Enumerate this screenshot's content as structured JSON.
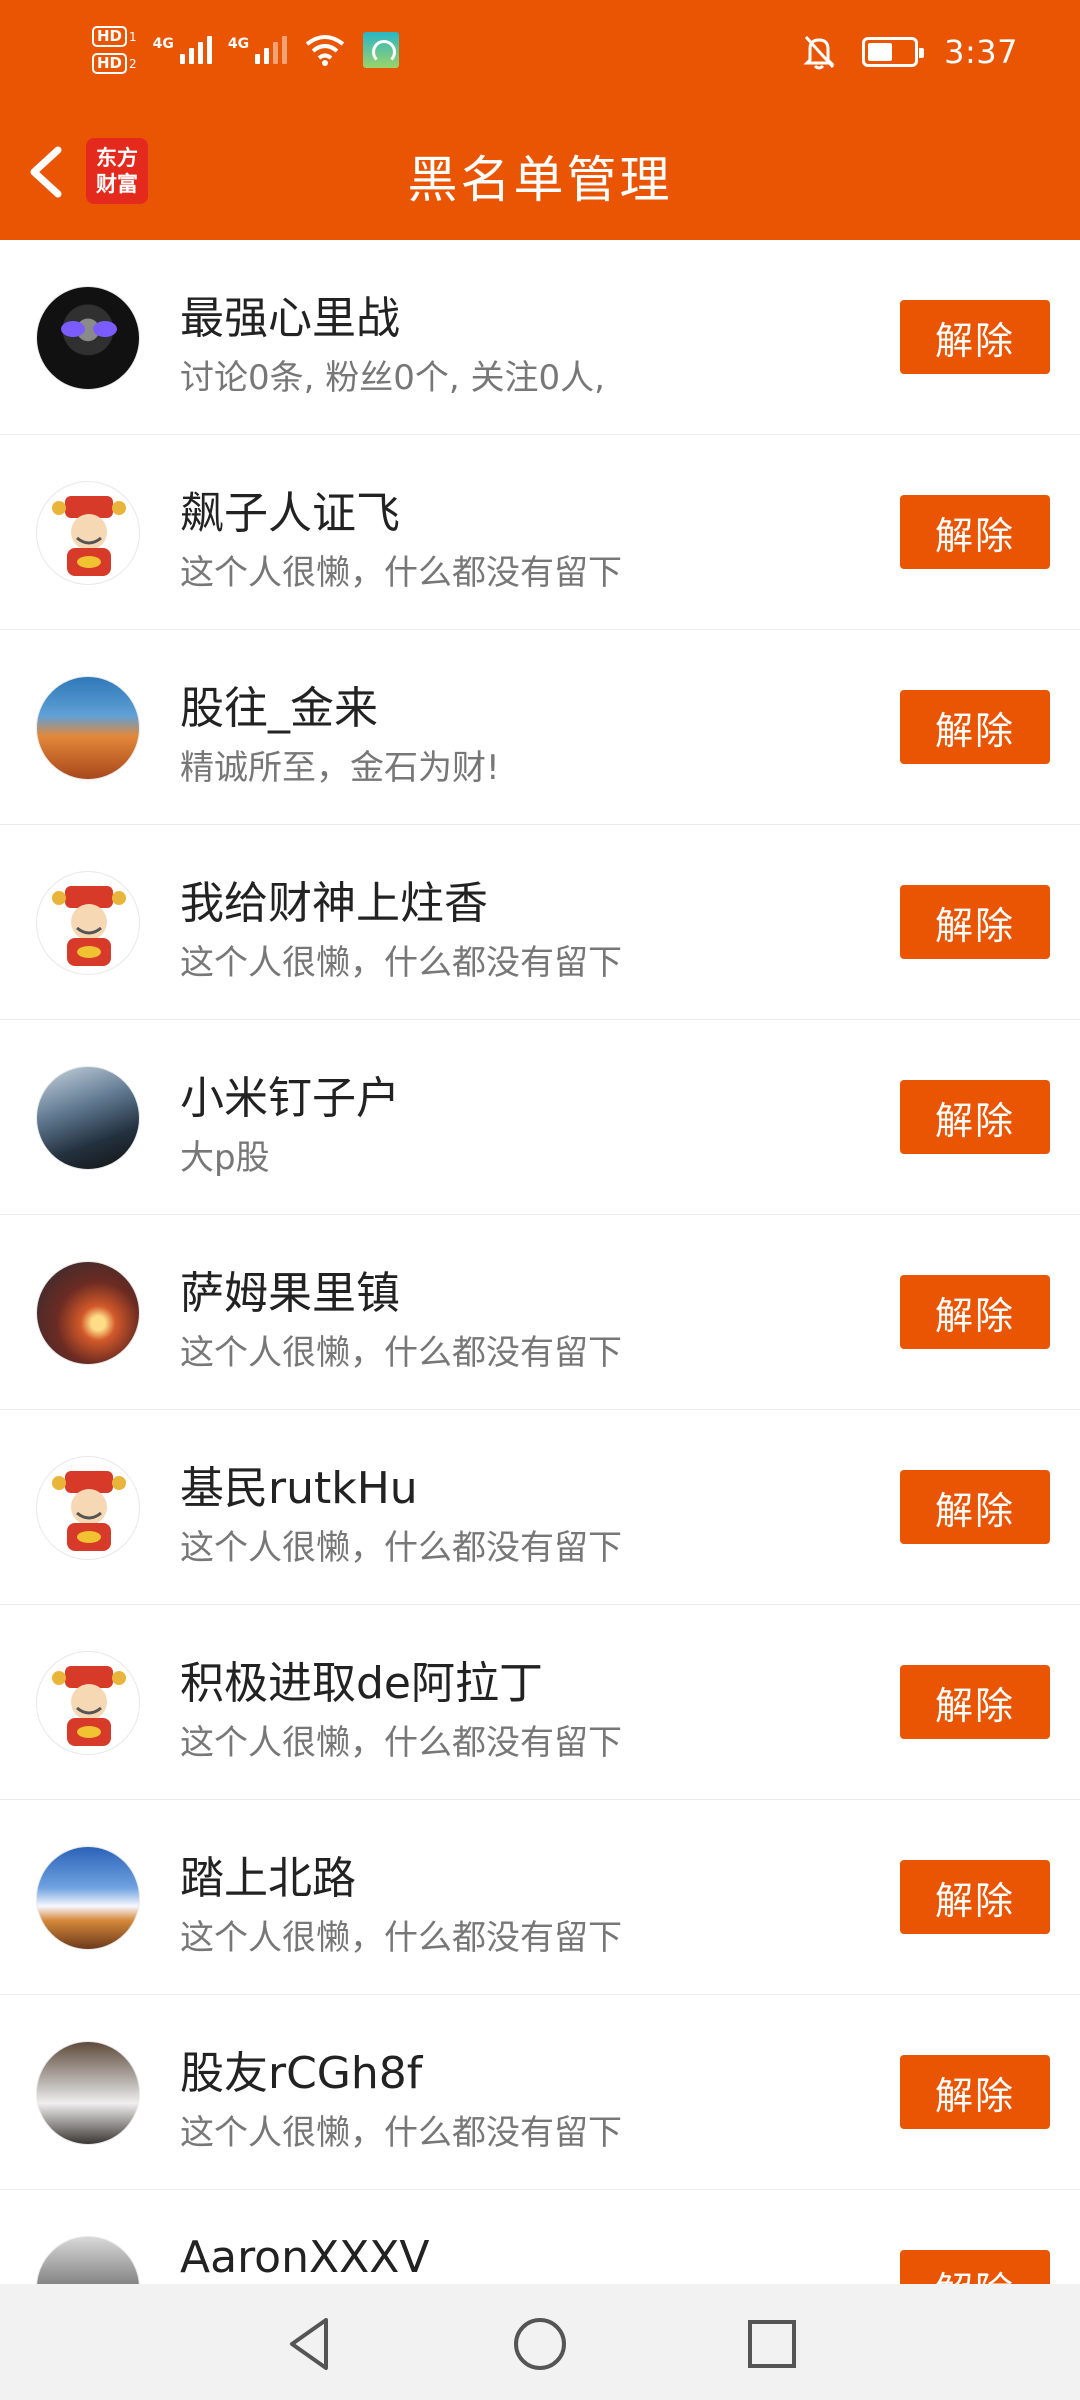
{
  "status_bar": {
    "sim1_label": "HD",
    "sim1_num": "1",
    "sim2_label": "HD",
    "sim2_num": "2",
    "net1": "4G",
    "net2": "4G",
    "time": "3:37"
  },
  "header": {
    "logo_line1": "东方",
    "logo_line2": "财富",
    "title": "黑名单管理"
  },
  "remove_label": "解除",
  "users": [
    {
      "name": "最强心里战",
      "desc": "讨论0条, 粉丝0个, 关注0人,",
      "avatar": "skull-avatar"
    },
    {
      "name": "飙子人证飞",
      "desc": "这个人很懒，什么都没有留下",
      "avatar": "fortune-god-avatar"
    },
    {
      "name": "股往_金来",
      "desc": "精诚所至，金石为财!",
      "avatar": "mountain-avatar"
    },
    {
      "name": "我给财神上炷香",
      "desc": "这个人很懒，什么都没有留下",
      "avatar": "fortune-god-avatar"
    },
    {
      "name": "小米钉子户",
      "desc": "大p股",
      "avatar": "seaside-person-avatar"
    },
    {
      "name": "萨姆果里镇",
      "desc": "这个人很懒，什么都没有留下",
      "avatar": "ironman-avatar"
    },
    {
      "name": "基民rutkHu",
      "desc": "这个人很懒，什么都没有留下",
      "avatar": "fortune-god-avatar"
    },
    {
      "name": "积极进取de阿拉丁",
      "desc": "这个人很懒，什么都没有留下",
      "avatar": "fortune-god-avatar"
    },
    {
      "name": "踏上北路",
      "desc": "这个人很懒，什么都没有留下",
      "avatar": "snow-mountain-avatar"
    },
    {
      "name": "股友rCGh8f",
      "desc": "这个人很懒，什么都没有留下",
      "avatar": "girl-photo-avatar"
    },
    {
      "name": "AaronXXXV",
      "desc": "",
      "avatar": "bw-photo-avatar"
    }
  ]
}
